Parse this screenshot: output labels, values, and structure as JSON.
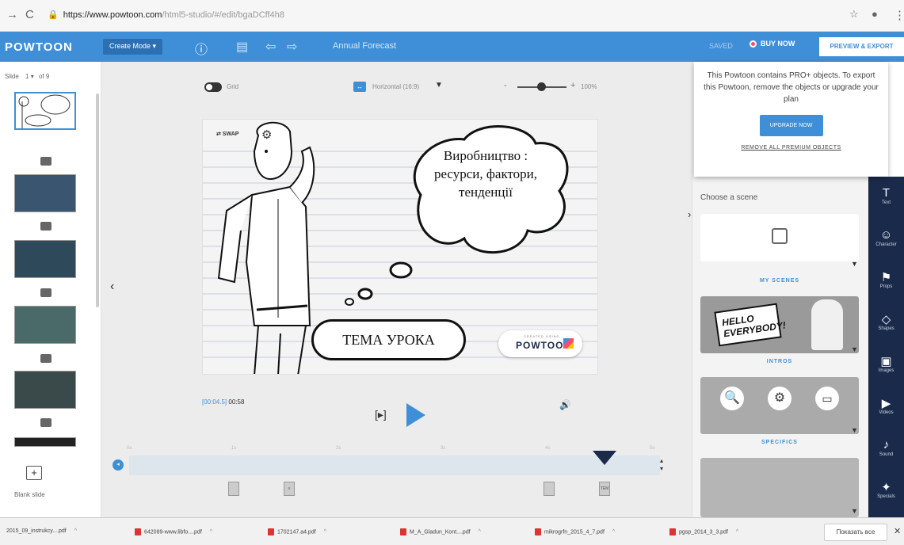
{
  "browser": {
    "url_host": "https://www.powtoon.com",
    "url_path": "/html5-studio/#/edit/bgaDCff4h8"
  },
  "header": {
    "logo": "POWTOON",
    "create_mode": "Create Mode ▾",
    "project_title": "Annual Forecast",
    "saved": "SAVED",
    "buy_now": "BUY NOW",
    "preview_export": "PREVIEW & EXPORT"
  },
  "slides": {
    "label": "Slide",
    "current": "1 ▾",
    "of": "of 9",
    "blank_slide": "Blank slide"
  },
  "toolbar": {
    "grid": "Grid",
    "orientation": "Horizontal (16:9)",
    "zoom": "100%"
  },
  "canvas": {
    "swap": "⇄ SWAP",
    "bubble_text": "Виробництво : ресурси, фактори, тенденції",
    "tema": "ТЕМА УРОКА",
    "badge_small": "CREATED USING",
    "badge_big": "POWTOON"
  },
  "player": {
    "timecode_start": "[00:04.5]",
    "timecode_total": "00:58",
    "frame_button": "[▸]"
  },
  "timeline": {
    "ticks": [
      "0s",
      "1s",
      "2s",
      "3s",
      "4s",
      "5s"
    ],
    "objects": [
      "",
      "≡",
      "",
      "TEM"
    ]
  },
  "popup": {
    "message": "This Powtoon contains PRO+ objects. To export this Powtoon, remove the objects or upgrade your plan",
    "upgrade": "UPGRADE NOW",
    "remove": "REMOVE ALL PREMIUM OBJECTS"
  },
  "scenes": {
    "choose": "Choose a scene",
    "my_scenes": "MY SCENES",
    "intros": "INTROS",
    "specifics": "SPECIFICS",
    "hello_text": "HELLO EVERYBODY!"
  },
  "tools": [
    {
      "icon": "T",
      "label": "Text"
    },
    {
      "icon": "☺",
      "label": "Character"
    },
    {
      "icon": "⚑",
      "label": "Props"
    },
    {
      "icon": "◇",
      "label": "Shapes"
    },
    {
      "icon": "▣",
      "label": "Images"
    },
    {
      "icon": "▶",
      "label": "Videos"
    },
    {
      "icon": "♪",
      "label": "Sound"
    },
    {
      "icon": "✦",
      "label": "Specials"
    }
  ],
  "downloads": [
    "2015_09_instrukcy....pdf",
    "642089-www.libfo....pdf",
    "1702147.a4.pdf",
    "M_A_Gladun_Kont....pdf",
    "mikrogrfn_2015_4_7.pdf",
    "pgsp_2014_3_3.pdf"
  ],
  "show_all": "Показать все"
}
